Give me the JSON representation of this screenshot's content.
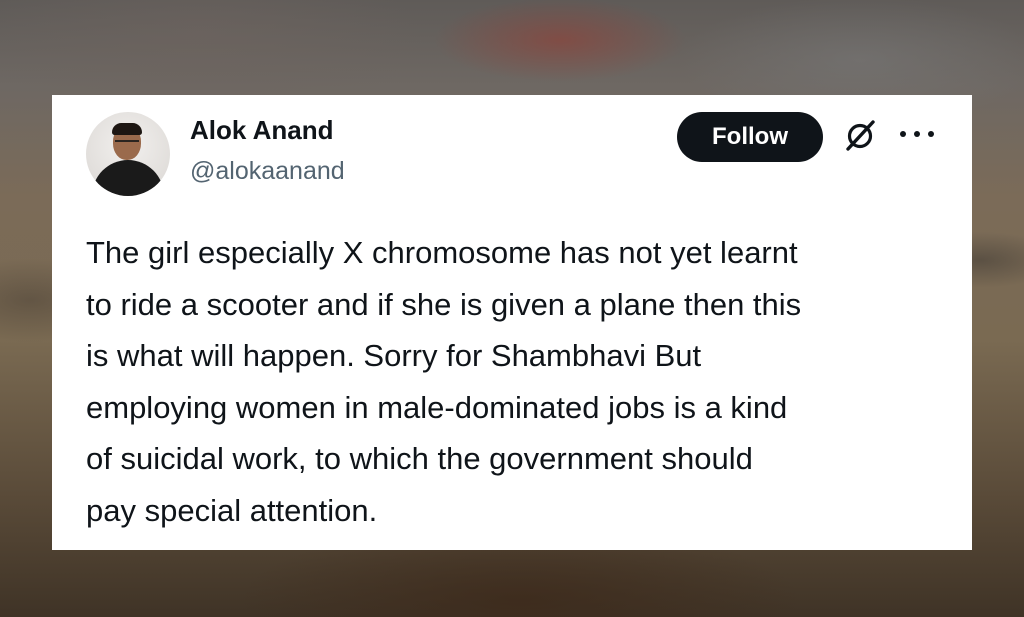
{
  "post": {
    "author_name": "Alok Anand",
    "author_handle": "@alokaanand",
    "follow_label": "Follow",
    "icons": {
      "avatar": "profile-photo",
      "grok": "grok-icon",
      "more": "more-options-icon"
    },
    "text": "The girl especially X chromosome has not yet learnt\nto ride a scooter and if she is given a plane then this\nis what will happen. Sorry for Shambhavi But\nemploying women in male-dominated jobs is a kind\nof suicidal work, to which the government should\npay special attention."
  },
  "colors": {
    "card_background": "#ffffff",
    "primary_text": "#0f1419",
    "secondary_text": "#536471",
    "button_background": "#0f1419",
    "button_text": "#ffffff"
  }
}
